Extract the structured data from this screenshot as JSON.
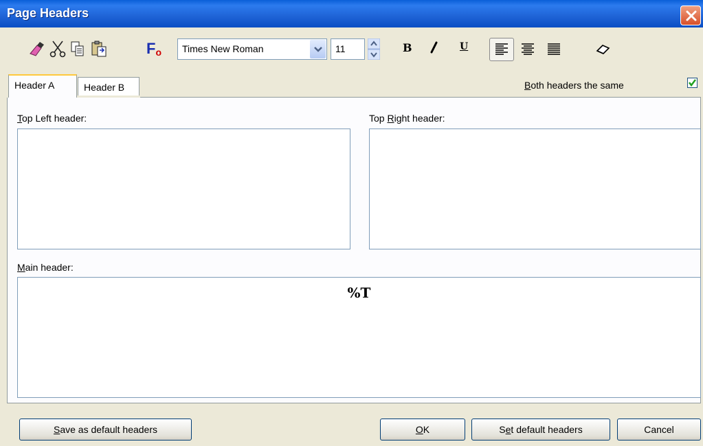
{
  "window": {
    "title": "Page Headers"
  },
  "toolbar": {
    "font_name": "Times New Roman",
    "font_size": "11",
    "font_icon_label": "F",
    "font_icon_sub": "o",
    "bold": "B",
    "italic": "I",
    "underline": "U"
  },
  "tabs": [
    {
      "label": "Header A",
      "active": true
    },
    {
      "label": "Header B",
      "active": false
    }
  ],
  "both_same": {
    "label_pre": "",
    "label_key": "B",
    "label_post": "oth headers the same",
    "checked": true
  },
  "top_left": {
    "label_key": "T",
    "label_post": "op Left header:",
    "value": ""
  },
  "top_right": {
    "label_pre": "Top ",
    "label_key": "R",
    "label_post": "ight header:",
    "value": ""
  },
  "main": {
    "label_key": "M",
    "label_post": "ain header:",
    "value": "%T"
  },
  "buttons": {
    "save_default_key": "S",
    "save_default_post": "ave as default headers",
    "ok_key": "O",
    "ok_post": "K",
    "set_default_pre": "S",
    "set_default_key": "e",
    "set_default_post": "t default headers",
    "cancel": "Cancel"
  },
  "colors": {
    "title_bar": "#0A5FD8",
    "face": "#ECE9D8",
    "border": "#7F9DB9",
    "tab_highlight": "#FFC83C",
    "font_icon_blue": "#1A2FB0",
    "font_icon_red": "#D00000"
  }
}
